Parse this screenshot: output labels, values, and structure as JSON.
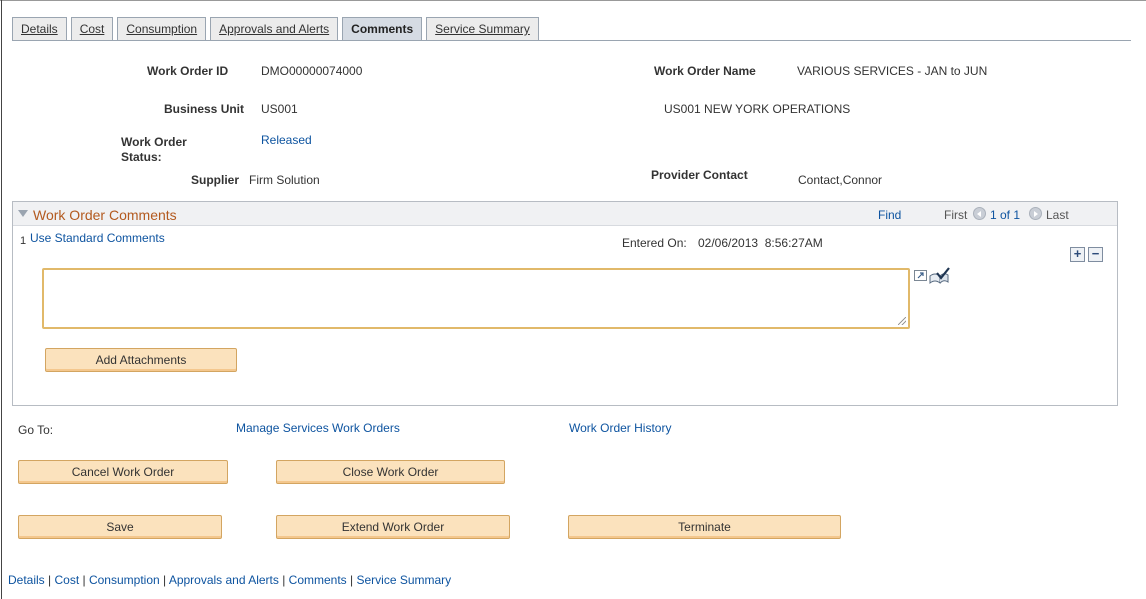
{
  "tabs": [
    {
      "label": "Details",
      "active": false
    },
    {
      "label": "Cost",
      "active": false
    },
    {
      "label": "Consumption",
      "active": false
    },
    {
      "label": "Approvals and Alerts",
      "active": false
    },
    {
      "label": "Comments",
      "active": true
    },
    {
      "label": "Service Summary",
      "active": false
    }
  ],
  "header": {
    "work_order_id_label": "Work Order ID",
    "work_order_id": "DMO00000074000",
    "work_order_name_label": "Work Order Name",
    "work_order_name": "VARIOUS SERVICES - JAN to JUN",
    "business_unit_label": "Business Unit",
    "business_unit": "US001",
    "business_unit_desc": "US001 NEW YORK OPERATIONS",
    "status_label_line1": "Work Order",
    "status_label_line2": "Status:",
    "status": "Released",
    "supplier_label": "Supplier",
    "supplier": "Firm Solution",
    "provider_contact_label": "Provider Contact",
    "provider_contact": "Contact,Connor"
  },
  "comments_grid": {
    "title": "Work Order Comments",
    "find": "Find",
    "first": "First",
    "page_info": "1 of 1",
    "last": "Last",
    "row_number": "1",
    "use_standard_comments": "Use Standard Comments",
    "entered_on_label": "Entered On:",
    "entered_on": "02/06/2013  8:56:27AM",
    "comment_value": "",
    "add_row": "+",
    "delete_row": "−",
    "add_attachments": "Add Attachments"
  },
  "goto": {
    "label": "Go To:",
    "manage_link": "Manage Services Work Orders",
    "history_link": "Work Order History"
  },
  "actions": {
    "cancel": "Cancel Work Order",
    "close": "Close Work Order",
    "save": "Save",
    "extend": "Extend Work Order",
    "terminate": "Terminate"
  },
  "footer": {
    "links": [
      "Details",
      "Cost",
      "Consumption",
      "Approvals and Alerts",
      "Comments",
      "Service Summary"
    ],
    "separator": " | "
  },
  "colors": {
    "link": "#0e54a0",
    "grid_title": "#b35a1f",
    "button_bg": "#fbe2bd",
    "textarea_border": "#e1b96a"
  }
}
